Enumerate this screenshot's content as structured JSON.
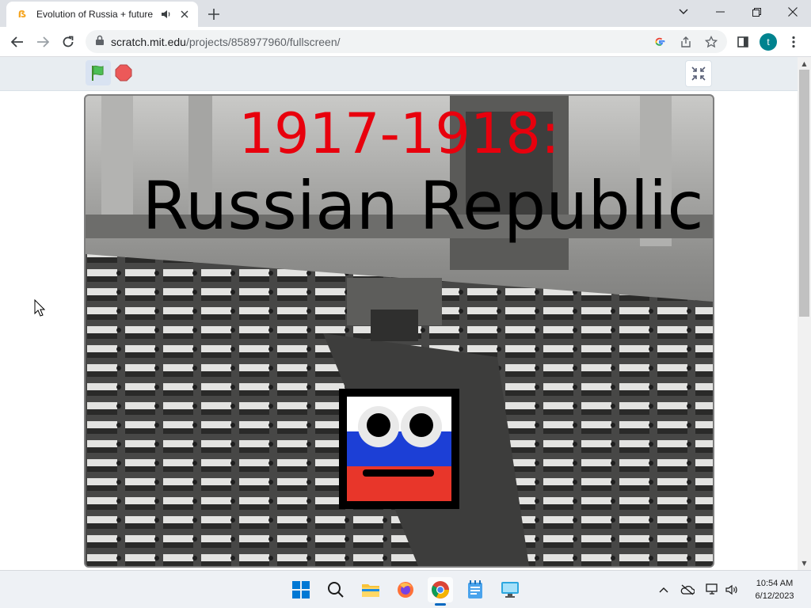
{
  "browser": {
    "tab": {
      "title": "Evolution of Russia + future"
    },
    "url": {
      "host": "scratch.mit.edu",
      "path": "/projects/858977960/fullscreen/"
    },
    "profile_initial": "t"
  },
  "stage": {
    "heading_years": "1917-1918:",
    "heading_title": "Russian Republic",
    "colors": {
      "years": "#e8000d",
      "title": "#000000"
    }
  },
  "taskbar": {
    "time": "10:54 AM",
    "date": "6/12/2023"
  }
}
